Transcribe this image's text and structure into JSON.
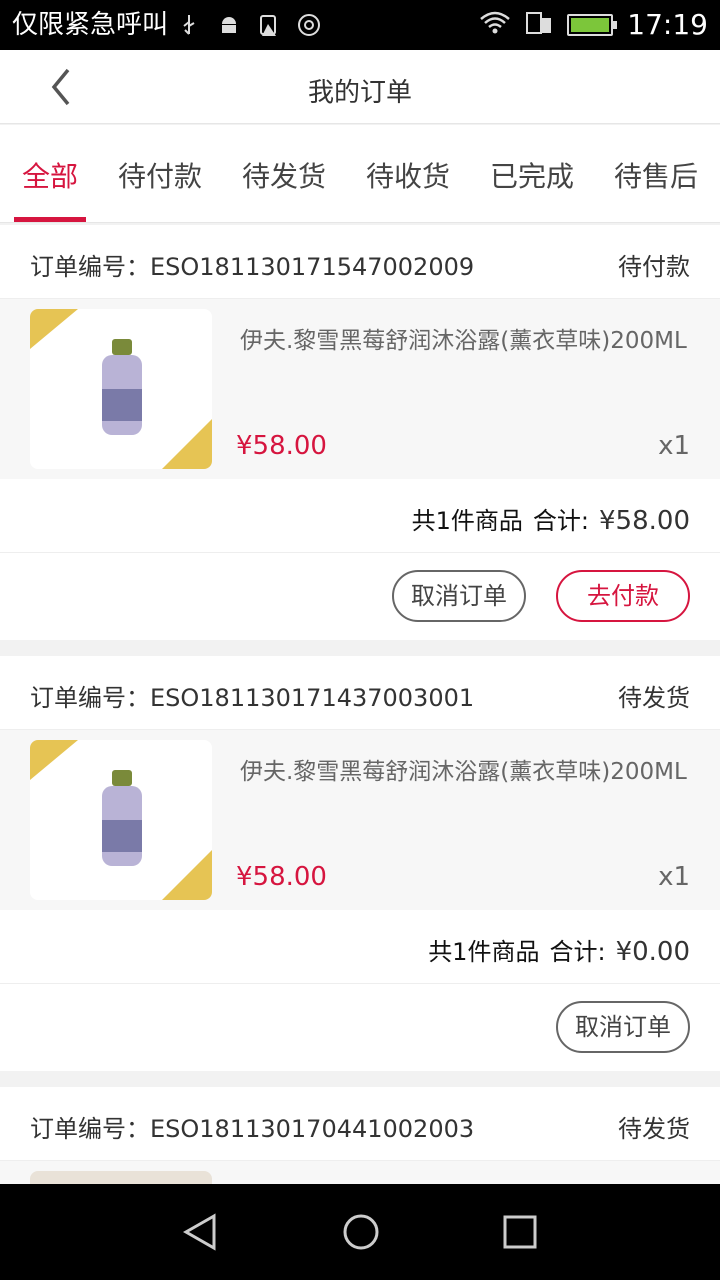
{
  "status_bar": {
    "carrier": "仅限紧急呼叫",
    "time": "17:19",
    "icons": [
      "usb-icon",
      "android-icon",
      "storage-warning-icon",
      "vpn-icon",
      "wifi-icon",
      "sim-icon",
      "battery-charging-icon"
    ]
  },
  "header": {
    "title": "我的订单",
    "back_icon": "chevron-left-icon"
  },
  "tabs": [
    {
      "label": "全部",
      "active": true
    },
    {
      "label": "待付款",
      "active": false
    },
    {
      "label": "待发货",
      "active": false
    },
    {
      "label": "待收货",
      "active": false
    },
    {
      "label": "已完成",
      "active": false
    },
    {
      "label": "待售后",
      "active": false
    }
  ],
  "orders": [
    {
      "number": "订单编号：ESO181130171547002009",
      "status": "待付款",
      "item": {
        "name": "伊夫.黎雪黑莓舒润沐浴露(薰衣草味)200ML",
        "price": "¥58.00",
        "qty": "x1"
      },
      "summary": {
        "count": "共1件商品",
        "total_label": "合计:",
        "total": "¥58.00"
      },
      "buttons": [
        "取消订单",
        "去付款"
      ]
    },
    {
      "number": "订单编号：ESO181130171437003001",
      "status": "待发货",
      "item": {
        "name": "伊夫.黎雪黑莓舒润沐浴露(薰衣草味)200ML",
        "price": "¥58.00",
        "qty": "x1"
      },
      "summary": {
        "count": "共1件商品",
        "total_label": "合计:",
        "total": "¥0.00"
      },
      "buttons": [
        "取消订单"
      ]
    },
    {
      "number": "订单编号：ESO181130170441002003",
      "status": "待发货"
    }
  ],
  "colors": {
    "accent": "#d6153f",
    "background": "#f2f2f2"
  },
  "nav_bar": {
    "icons": [
      "back-triangle-icon",
      "home-circle-icon",
      "recents-square-icon"
    ]
  }
}
